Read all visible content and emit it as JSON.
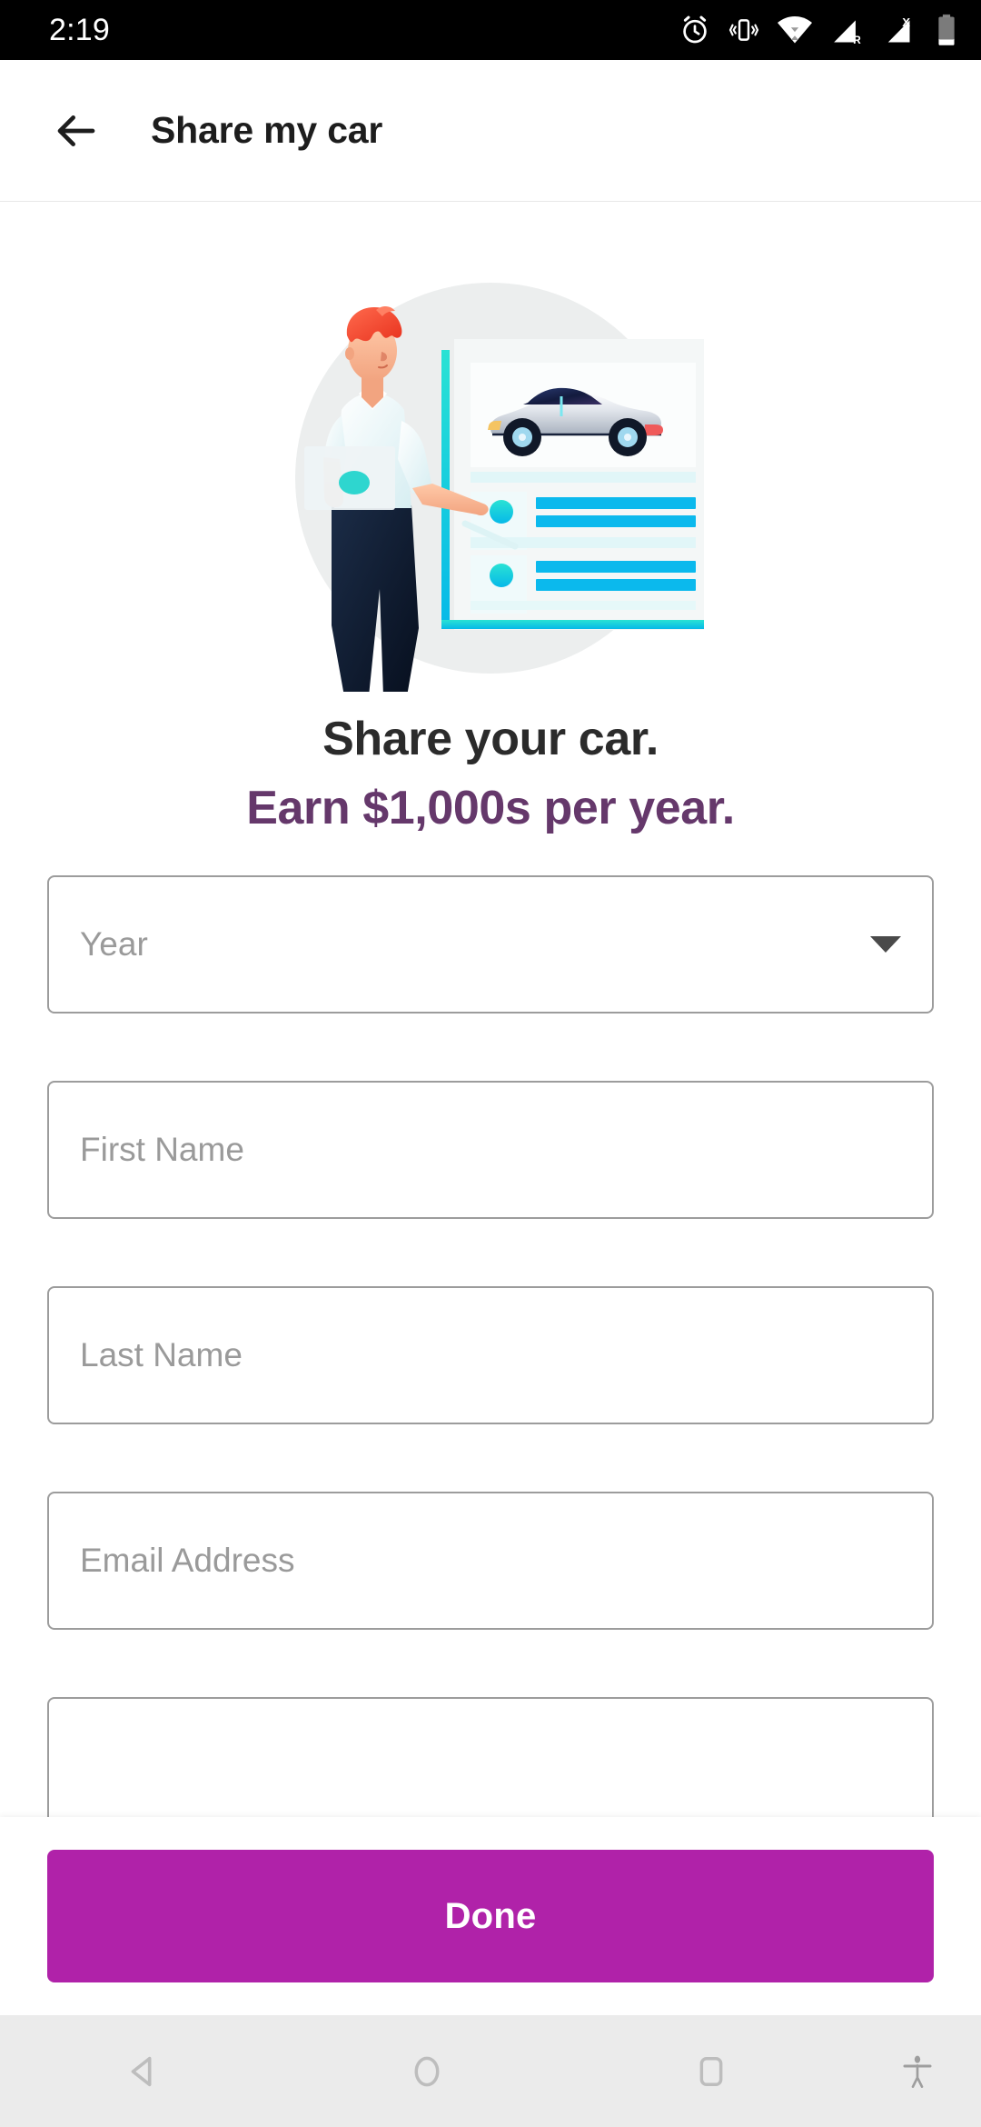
{
  "status_bar": {
    "time": "2:19",
    "icons": [
      {
        "name": "alarm-icon",
        "label": "alarm"
      },
      {
        "name": "vibrate-icon",
        "label": "vibrate"
      },
      {
        "name": "wifi-icon",
        "label": "wifi"
      },
      {
        "name": "signal-roaming-icon",
        "label": "signal R"
      },
      {
        "name": "signal-no-sim-icon",
        "label": "signal X"
      },
      {
        "name": "battery-low-icon",
        "label": "battery"
      }
    ],
    "roaming_badge": "R",
    "nosim_badge": "X",
    "background": "#000000",
    "foreground": "#ffffff"
  },
  "app_bar": {
    "back_icon": "back-arrow-icon",
    "title": "Share my car"
  },
  "hero": {
    "alt": "illustration of a person presenting a car listing board",
    "circle_color": "#eceeee",
    "accent_cyan": "#00c8f0",
    "accent_teal": "#27e0d8",
    "hair_color": "#f2462f",
    "pants_color": "#101d31",
    "shirt_color": "#ffffff"
  },
  "headline": {
    "line1": "Share your car.",
    "line2": "Earn $1,000s per year.",
    "line1_color": "#2b2b2b",
    "line2_color": "#65386b"
  },
  "form": {
    "fields": [
      {
        "name": "year-select",
        "placeholder": "Year",
        "type": "select",
        "value": ""
      },
      {
        "name": "first-name-input",
        "placeholder": "First Name",
        "type": "text",
        "value": ""
      },
      {
        "name": "last-name-input",
        "placeholder": "Last Name",
        "type": "text",
        "value": ""
      },
      {
        "name": "email-input",
        "placeholder": "Email Address",
        "type": "email",
        "value": ""
      },
      {
        "name": "phone-input",
        "placeholder": "",
        "type": "text",
        "value": ""
      }
    ],
    "border_color": "#9c9c9c",
    "placeholder_color": "#9a9a9a"
  },
  "action_bar": {
    "done_label": "Done",
    "done_color": "#b022a9",
    "done_text_color": "#ffffff"
  },
  "nav_bar": {
    "background": "#ebebeb",
    "icon_color": "#bdbdbd",
    "buttons": [
      {
        "name": "nav-back-button",
        "label": "Back"
      },
      {
        "name": "nav-home-button",
        "label": "Home"
      },
      {
        "name": "nav-recents-button",
        "label": "Recents"
      },
      {
        "name": "nav-accessibility-button",
        "label": "Accessibility"
      }
    ]
  }
}
